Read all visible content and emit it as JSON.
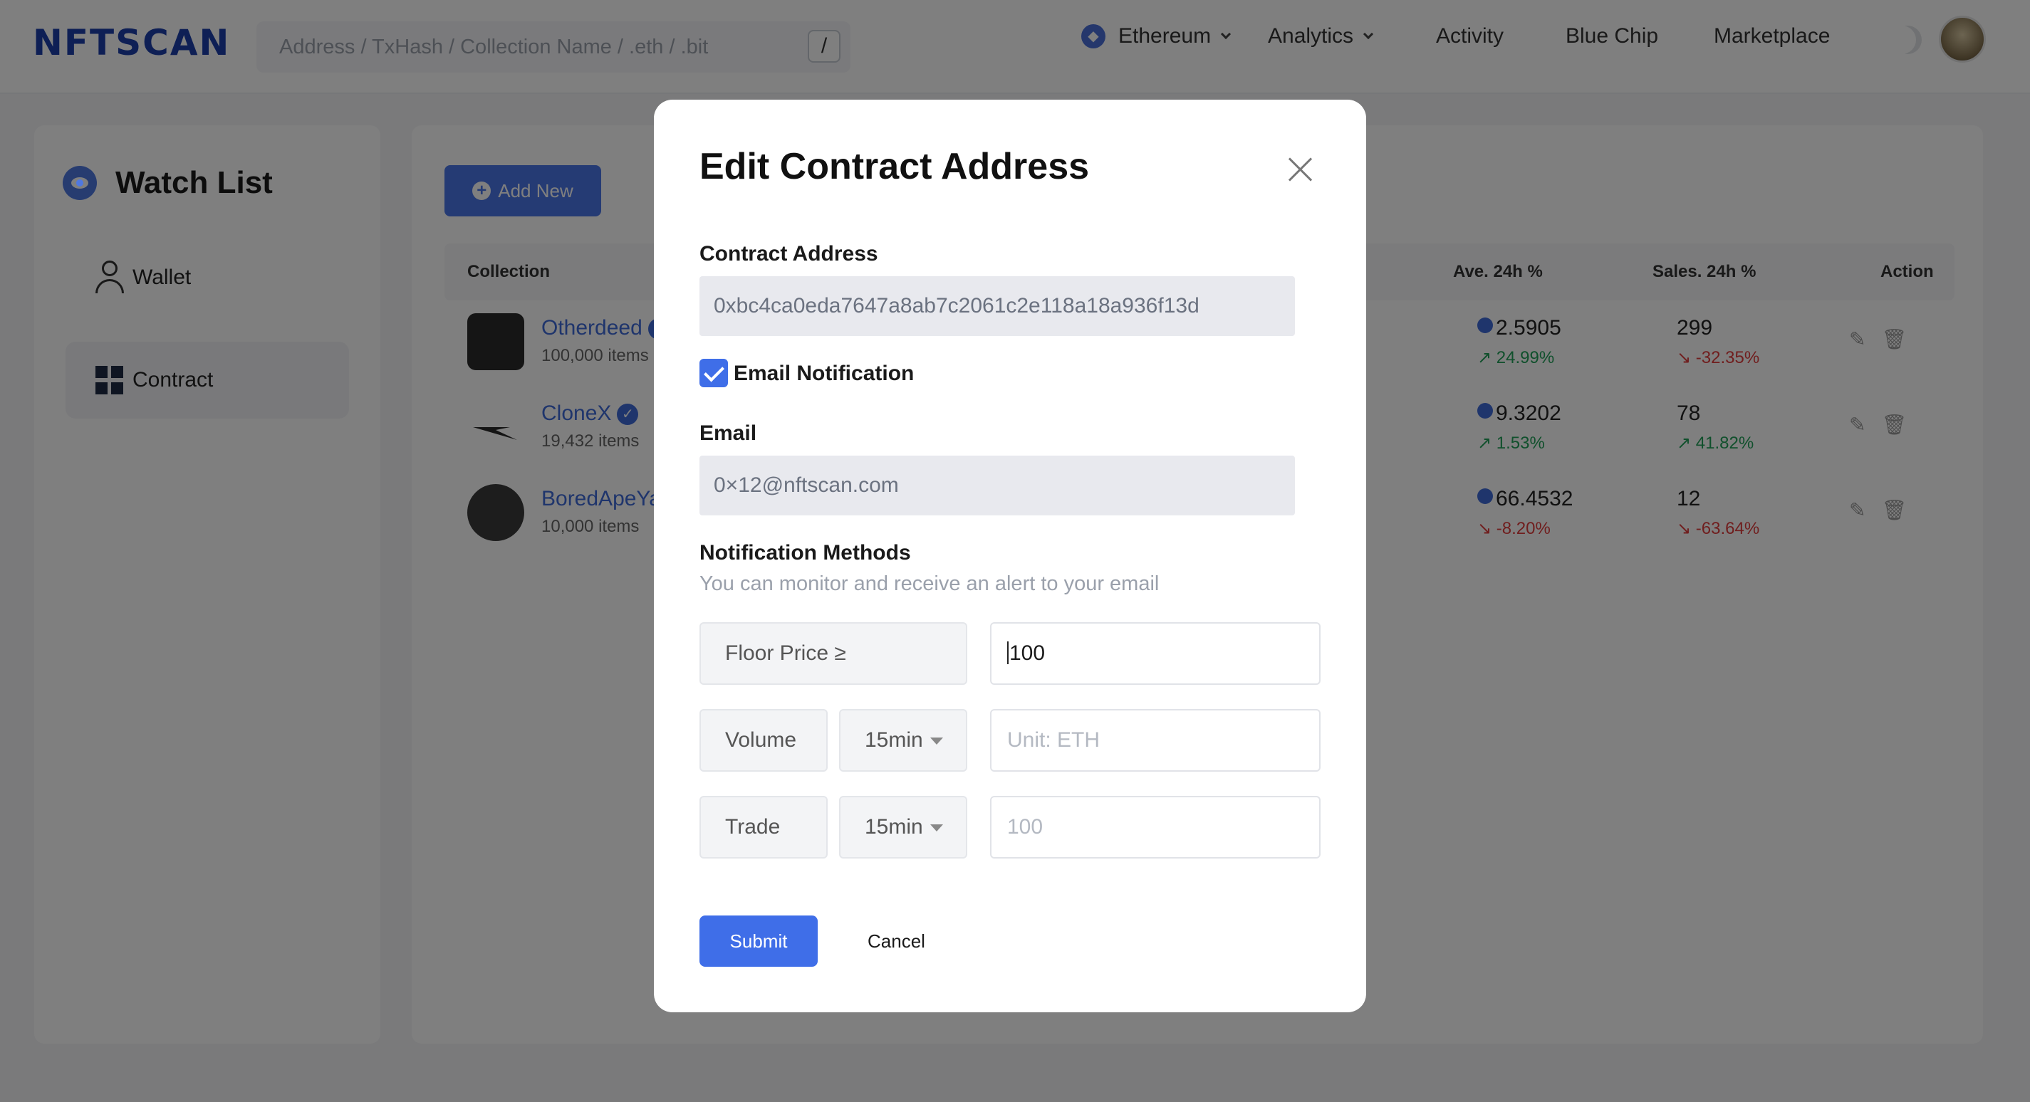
{
  "header": {
    "logo": "NFTSCAN",
    "search_placeholder": "Address / TxHash / Collection Name / .eth / .bit",
    "search_shortcut": "/",
    "nav": {
      "network": "Ethereum",
      "analytics": "Analytics",
      "activity": "Activity",
      "blue_chip": "Blue Chip",
      "marketplace": "Marketplace"
    }
  },
  "sidebar": {
    "title": "Watch List",
    "items": [
      {
        "label": "Wallet",
        "icon": "user-icon",
        "active": false
      },
      {
        "label": "Contract",
        "icon": "grid-icon",
        "active": true
      }
    ]
  },
  "main": {
    "add_new_label": "Add New",
    "table": {
      "columns": {
        "collection": "Collection",
        "ave": "Ave. 24h %",
        "sales": "Sales. 24h %",
        "action": "Action"
      },
      "rows": [
        {
          "name": "Otherdeed",
          "items": "100,000 items",
          "ave": "2.5905",
          "ave_change": "↗ 24.99%",
          "ave_dir": "up",
          "sales": "299",
          "sales_change": "↘ -32.35%",
          "sales_dir": "down"
        },
        {
          "name": "CloneX",
          "items": "19,432 items",
          "ave": "9.3202",
          "ave_change": "↗ 1.53%",
          "ave_dir": "up",
          "sales": "78",
          "sales_change": "↗ 41.82%",
          "sales_dir": "up"
        },
        {
          "name": "BoredApeYa",
          "items": "10,000 items",
          "ave": "66.4532",
          "ave_change": "↘ -8.20%",
          "ave_dir": "down",
          "sales": "12",
          "sales_change": "↘ -63.64%",
          "sales_dir": "down"
        }
      ]
    }
  },
  "modal": {
    "title": "Edit Contract Address",
    "contract_label": "Contract Address",
    "contract_value": "0xbc4ca0eda7647a8ab7c2061c2e118a18a936f13d",
    "email_notification_label": "Email Notification",
    "email_notification_checked": true,
    "email_label": "Email",
    "email_value": "0×12@nftscan.com",
    "methods_label": "Notification Methods",
    "methods_sub": "You can monitor and receive an alert to your email",
    "methods": {
      "floor": {
        "label": "Floor Price ≥",
        "value": "100"
      },
      "volume": {
        "label": "Volume",
        "interval": "15min",
        "placeholder": "Unit: ETH"
      },
      "trade": {
        "label": "Trade",
        "interval": "15min",
        "placeholder": "100"
      }
    },
    "submit_label": "Submit",
    "cancel_label": "Cancel"
  },
  "colors": {
    "accent": "#3f6ee8",
    "up": "#21a058",
    "down": "#e03c3c"
  }
}
